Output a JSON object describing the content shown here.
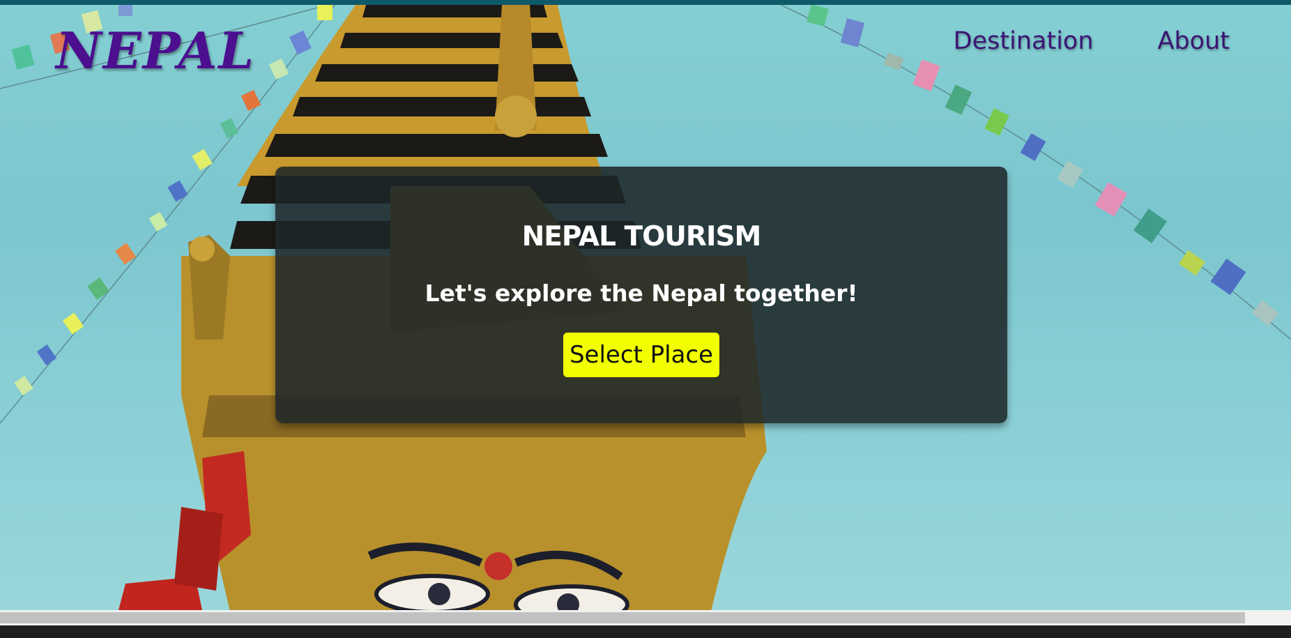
{
  "nav": {
    "logo": "NEPAL",
    "links": [
      "Destination",
      "About"
    ]
  },
  "hero": {
    "title": "NEPAL TOURISM",
    "subtitle": "Let's explore the Nepal together!",
    "cta_label": "Select Place"
  },
  "colors": {
    "logo": "#4b0f8f",
    "nav_link": "#3b1573",
    "card_bg": "#1d2628",
    "cta_bg": "#f1ff00",
    "sky": "#84cfd2"
  }
}
